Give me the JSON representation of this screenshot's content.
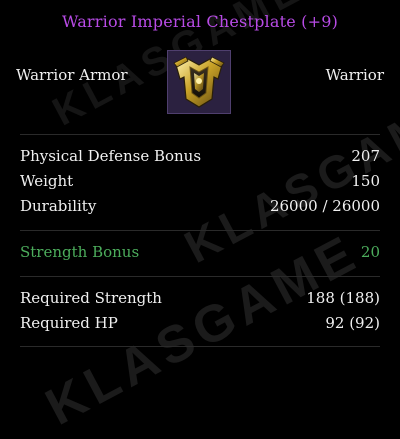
{
  "item": {
    "name": "Warrior Imperial Chestplate (+9)",
    "type": "Warrior Armor",
    "class": "Warrior",
    "icon": "chestplate-icon"
  },
  "stats": [
    {
      "label": "Physical Defense Bonus",
      "value": "207"
    },
    {
      "label": "Weight",
      "value": "150"
    },
    {
      "label": "Durability",
      "value": "26000 / 26000"
    }
  ],
  "bonus": {
    "label": "Strength Bonus",
    "value": "20"
  },
  "requirements": [
    {
      "label": "Required Strength",
      "value": "188 (188)"
    },
    {
      "label": "Required HP",
      "value": "92 (92)"
    }
  ],
  "watermark": "KLASGAME",
  "colors": {
    "background": "#000000",
    "title": "#b84be6",
    "text": "#f0f0f0",
    "bonus": "#4cad5c",
    "icon_background": "#2b2140"
  }
}
